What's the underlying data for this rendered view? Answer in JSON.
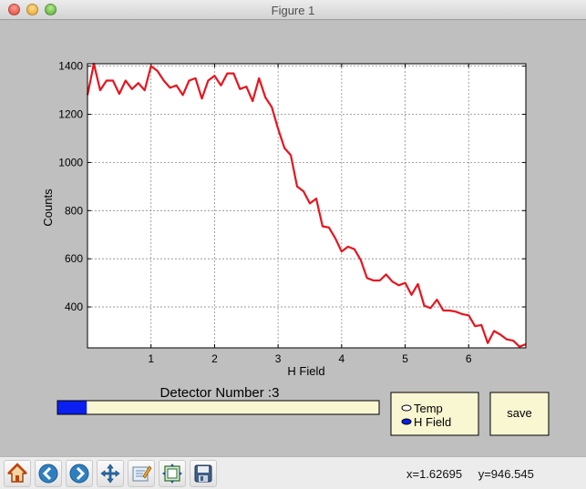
{
  "window": {
    "title": "Figure 1"
  },
  "chart_data": {
    "type": "line",
    "xlabel": "H Field",
    "ylabel": "Counts",
    "xlim": [
      0,
      6.9
    ],
    "ylim": [
      230,
      1410
    ],
    "xticks": [
      1,
      2,
      3,
      4,
      5,
      6
    ],
    "yticks": [
      400,
      600,
      800,
      1000,
      1200,
      1400
    ],
    "grid": true,
    "line_color": "#e8141e",
    "series": [
      {
        "x": [
          0.0,
          0.1,
          0.2,
          0.3,
          0.4,
          0.5,
          0.6,
          0.7,
          0.8,
          0.9,
          1.0,
          1.1,
          1.2,
          1.3,
          1.4,
          1.5,
          1.6,
          1.7,
          1.8,
          1.9,
          2.0,
          2.1,
          2.2,
          2.3,
          2.4,
          2.5,
          2.6,
          2.7,
          2.8,
          2.9,
          3.0,
          3.1,
          3.2,
          3.3,
          3.4,
          3.5,
          3.6,
          3.7,
          3.8,
          3.9,
          4.0,
          4.1,
          4.2,
          4.3,
          4.4,
          4.5,
          4.6,
          4.7,
          4.8,
          4.9,
          5.0,
          5.1,
          5.2,
          5.3,
          5.4,
          5.5,
          5.6,
          5.7,
          5.8,
          5.9,
          6.0,
          6.1,
          6.2,
          6.3,
          6.4,
          6.5,
          6.6,
          6.7,
          6.8,
          6.9
        ],
        "y": [
          1280,
          1410,
          1300,
          1340,
          1340,
          1285,
          1340,
          1305,
          1330,
          1300,
          1400,
          1380,
          1340,
          1310,
          1320,
          1280,
          1340,
          1350,
          1265,
          1340,
          1360,
          1320,
          1370,
          1370,
          1305,
          1315,
          1255,
          1350,
          1270,
          1230,
          1140,
          1060,
          1030,
          900,
          880,
          830,
          850,
          735,
          730,
          685,
          630,
          650,
          640,
          595,
          520,
          510,
          510,
          535,
          505,
          490,
          500,
          450,
          495,
          405,
          395,
          430,
          385,
          385,
          380,
          370,
          365,
          320,
          325,
          250,
          300,
          285,
          265,
          260,
          235,
          245
        ]
      }
    ]
  },
  "detector": {
    "label": "Detector Number :3",
    "progress": 0.09
  },
  "radio": {
    "options": [
      "Temp",
      "H Field"
    ],
    "selected": 1
  },
  "save_label": "save",
  "colors": {
    "progress_fill": "#0a1ff0",
    "widget_bg": "#f9f6d2"
  },
  "toolbar": {
    "icons": [
      "home-icon",
      "back-arrow-icon",
      "forward-arrow-icon",
      "pan-icon",
      "zoom-icon",
      "subplots-icon",
      "save-icon"
    ]
  },
  "status": {
    "x": "x=1.62695",
    "y": "y=946.545"
  }
}
